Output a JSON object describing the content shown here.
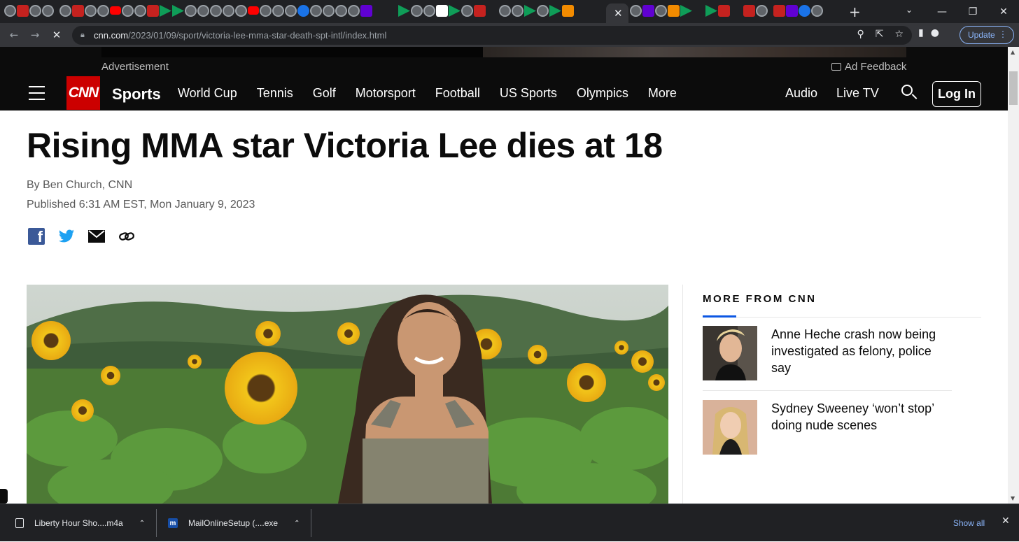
{
  "browser": {
    "url_host": "cnn.com",
    "url_path": "/2023/01/09/sport/victoria-lee-mma-star-death-spt-intl/index.html",
    "update_label": "Update",
    "close_tab_glyph": "✕",
    "new_tab_glyph": "+"
  },
  "ad": {
    "label": "Advertisement",
    "feedback": "Ad Feedback"
  },
  "nav": {
    "logo": "CNN",
    "section": "Sports",
    "links": [
      "World Cup",
      "Tennis",
      "Golf",
      "Motorsport",
      "Football",
      "US Sports",
      "Olympics",
      "More"
    ],
    "audio": "Audio",
    "live_tv": "Live TV",
    "login": "Log In"
  },
  "article": {
    "headline": "Rising MMA star Victoria Lee dies at 18",
    "byline": "By Ben Church, CNN",
    "published": "Published 6:31 AM EST, Mon January 9, 2023"
  },
  "sidebar": {
    "heading": "MORE FROM CNN",
    "stories": [
      {
        "title": "Anne Heche crash now being investigated as felony, police say"
      },
      {
        "title": "Sydney Sweeney ‘won’t stop’ doing nude scenes"
      }
    ]
  },
  "downloads": {
    "items": [
      {
        "name": "Liberty Hour Sho....m4a"
      },
      {
        "name": "MailOnlineSetup (....exe"
      }
    ],
    "show_all": "Show all"
  },
  "colors": {
    "cnn_red": "#cc0000",
    "accent_blue": "#0c57e3",
    "chrome_dark": "#202124"
  }
}
